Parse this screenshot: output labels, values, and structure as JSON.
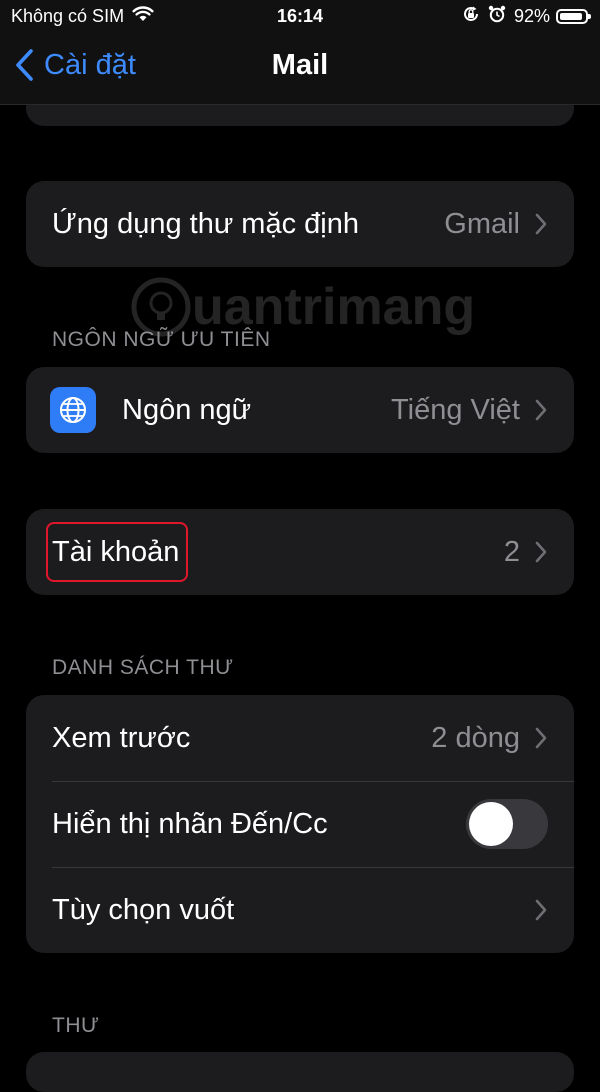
{
  "status_bar": {
    "carrier": "Không có SIM",
    "time": "16:14",
    "battery_percent_label": "92%",
    "battery_level": 0.92
  },
  "nav": {
    "back_label": "Cài đặt",
    "title": "Mail"
  },
  "default_app": {
    "label": "Ứng dụng thư mặc định",
    "value": "Gmail"
  },
  "preferred_language": {
    "header": "NGÔN NGỮ ƯU TIÊN",
    "label": "Ngôn ngữ",
    "value": "Tiếng Việt",
    "icon": "globe-icon"
  },
  "accounts": {
    "label": "Tài khoản",
    "value": "2"
  },
  "message_list": {
    "header": "DANH SÁCH THƯ",
    "preview_label": "Xem trước",
    "preview_value": "2 dòng",
    "show_to_cc_label": "Hiển thị nhãn Đến/Cc",
    "show_to_cc_on": false,
    "swipe_options_label": "Tùy chọn vuốt"
  },
  "messages": {
    "header": "THƯ"
  },
  "watermark": {
    "text": "uantrimang"
  },
  "colors": {
    "accent": "#3d8bfd",
    "highlight": "#e0162b",
    "background": "#000000",
    "cell": "#1c1c1e"
  }
}
